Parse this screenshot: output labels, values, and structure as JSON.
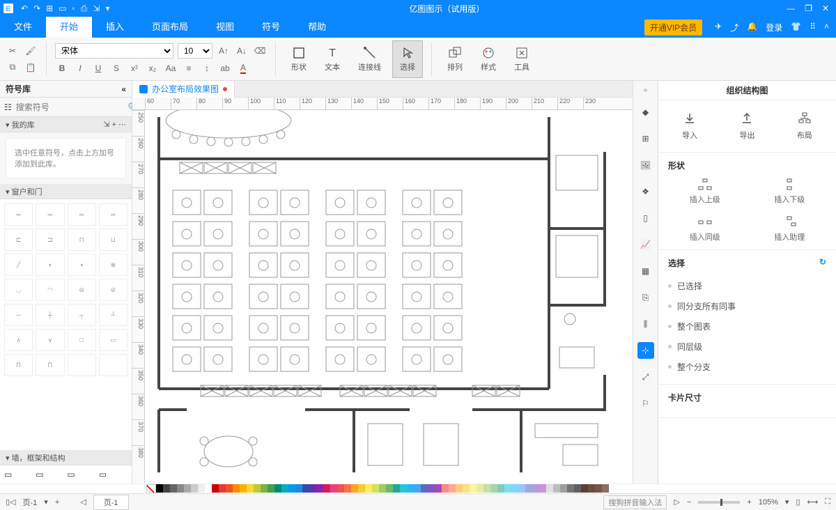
{
  "app": {
    "title": "亿图图示（试用版）"
  },
  "menus": {
    "file": "文件",
    "home": "开始",
    "insert": "插入",
    "layout": "页面布局",
    "view": "视图",
    "symbol": "符号",
    "help": "帮助",
    "vip": "开通VIP会员",
    "login": "登录"
  },
  "ribbon": {
    "font": "宋体",
    "size": "10",
    "shape": "形状",
    "text": "文本",
    "connector": "连接线",
    "select": "选择",
    "arrange": "排列",
    "style": "样式",
    "tools": "工具"
  },
  "left": {
    "title": "符号库",
    "searchPlaceholder": "搜索符号",
    "myLib": "我的库",
    "hint": "选中任意符号，点击上方加号添加到此库。",
    "sec1": "窗户和门",
    "sec2": "墙，框架和结构"
  },
  "doc": {
    "name": "办公室布局效果图"
  },
  "ruler": {
    "h": [
      "60",
      "70",
      "80",
      "90",
      "100",
      "110",
      "120",
      "130",
      "140",
      "150",
      "160",
      "170",
      "180",
      "190",
      "200",
      "210",
      "220",
      "230"
    ],
    "v": [
      "250",
      "260",
      "270",
      "280",
      "290",
      "300",
      "310",
      "320",
      "330",
      "340",
      "350",
      "360",
      "370",
      "380"
    ]
  },
  "right": {
    "title": "组织结构图",
    "import": "导入",
    "export": "导出",
    "layout": "布局",
    "shapeSec": "形状",
    "insUp": "插入上级",
    "insDown": "插入下级",
    "insSame": "插入同级",
    "insAsst": "插入助理",
    "selectSec": "选择",
    "opts": [
      "已选择",
      "同分支所有同事",
      "整个图表",
      "同层级",
      "整个分支"
    ],
    "cardSec": "卡片尺寸"
  },
  "status": {
    "page": "页-1",
    "pageBtn": "页-1",
    "ime": "搜狗拼音输入法",
    "zoom": "105%"
  },
  "colors": [
    "#000",
    "#444",
    "#666",
    "#888",
    "#aaa",
    "#ccc",
    "#eee",
    "#fff",
    "#c00",
    "#e53935",
    "#f4511e",
    "#fb8c00",
    "#ffb300",
    "#fdd835",
    "#c0ca33",
    "#7cb342",
    "#43a047",
    "#00897b",
    "#00acc1",
    "#039be5",
    "#1e88e5",
    "#3949ab",
    "#5e35b1",
    "#8e24aa",
    "#d81b60",
    "#ec407a",
    "#ef5350",
    "#ff7043",
    "#ffa726",
    "#ffca28",
    "#ffee58",
    "#d4e157",
    "#9ccc65",
    "#66bb6a",
    "#26a69a",
    "#26c6da",
    "#29b6f6",
    "#42a5f5",
    "#5c6bc0",
    "#7e57c2",
    "#ab47bc",
    "#ff8a80",
    "#ffab91",
    "#ffcc80",
    "#ffe082",
    "#fff59d",
    "#e6ee9c",
    "#c5e1a5",
    "#a5d6a7",
    "#80cbc4",
    "#80deea",
    "#81d4fa",
    "#90caf9",
    "#9fa8da",
    "#b39ddb",
    "#ce93d8",
    "#e0e0e0",
    "#bdbdbd",
    "#9e9e9e",
    "#757575",
    "#616161",
    "#5d4037",
    "#6d4c41",
    "#795548",
    "#8d6e63"
  ]
}
